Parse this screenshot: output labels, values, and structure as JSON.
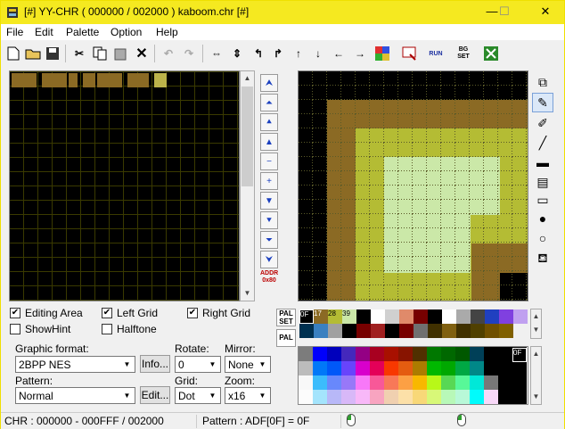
{
  "window": {
    "title": "[#] YY-CHR ( 000000 / 002000 ) kaboom.chr [#]",
    "minimize": "—",
    "maximize": "☐",
    "close": "✕"
  },
  "menu": [
    "File",
    "Edit",
    "Palette",
    "Option",
    "Help"
  ],
  "toolbar": {
    "icons": [
      "new-icon",
      "open-icon",
      "save-icon",
      "cut-icon",
      "copy-icon",
      "paste-icon",
      "delete-icon",
      "undo-icon",
      "redo-icon",
      "flip-horizontal-icon",
      "flip-vertical-icon",
      "rotate-left-icon",
      "rotate-right-icon",
      "shift-up-icon",
      "shift-down-icon",
      "shift-left-icon",
      "shift-right-icon",
      "color-replace-icon",
      "script-icon",
      "run-icon",
      "bg-set-icon",
      "plugin-icon"
    ],
    "run_label": "RUN",
    "bgset_label": "BG SET"
  },
  "nav": {
    "buttons": [
      "⮝",
      "⏶",
      "⯅",
      "▲",
      "−",
      "+",
      "▼",
      "⯆",
      "⏷",
      "⮟"
    ],
    "addr_label": "ADDR",
    "addr_value": "0x80"
  },
  "options": {
    "editing_area": {
      "label": "Editing Area",
      "checked": true
    },
    "left_grid": {
      "label": "Left Grid",
      "checked": true
    },
    "right_grid": {
      "label": "Right Grid",
      "checked": true
    },
    "show_hint": {
      "label": "ShowHint",
      "checked": false
    },
    "halftone": {
      "label": "Halftone",
      "checked": false
    }
  },
  "graphic_format": {
    "label": "Graphic format:",
    "value": "2BPP NES",
    "info_button": "Info..."
  },
  "rotate": {
    "label": "Rotate:",
    "value": "0"
  },
  "mirror": {
    "label": "Mirror:",
    "value": "None"
  },
  "pattern": {
    "label": "Pattern:",
    "value": "Normal",
    "edit_button": "Edit..."
  },
  "grid": {
    "label": "Grid:",
    "value": "Dot"
  },
  "zoom": {
    "label": "Zoom:",
    "value": "x16"
  },
  "palette": {
    "pal_set": "PAL SET",
    "pal": "PAL",
    "selected_codes": [
      "0F",
      "17",
      "28",
      "39"
    ],
    "big_selected": "0F"
  },
  "status": {
    "chr": "CHR : 000000 - 000FFF / 002000",
    "pattern": "Pattern : ADF[0F] = 0F"
  },
  "colors": {
    "titlebar": "#f5e920",
    "brown": "#8b6a24",
    "olive": "#b4bc34",
    "light_green": "#cbe8a8"
  }
}
